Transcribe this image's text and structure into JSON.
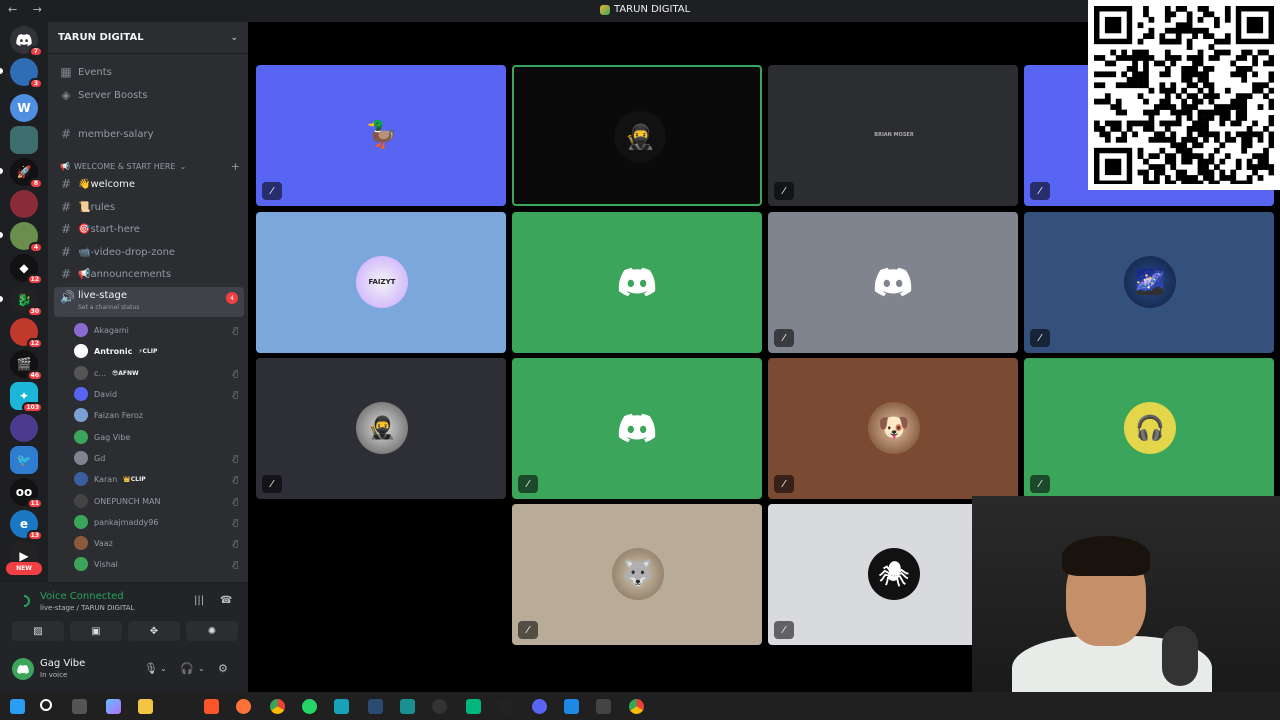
{
  "window": {
    "title": "TARUN DIGITAL",
    "nav": "← →"
  },
  "rail": {
    "badges": [
      "7",
      "3",
      "8",
      "4",
      "12",
      "30",
      "12",
      "46",
      "103",
      "11",
      "13"
    ],
    "new_label": "NEW",
    "server_names": [
      "discord-home-icon",
      "server-icon"
    ]
  },
  "sidebar": {
    "server_name": "TARUN DIGITAL",
    "items": [
      {
        "label": "Events"
      },
      {
        "label": "Server Boosts"
      },
      {
        "label": "member-salary"
      }
    ],
    "category": "WELCOME & START HERE",
    "channels": [
      {
        "label": "👋welcome"
      },
      {
        "label": "📜rules"
      },
      {
        "label": "🎯start-here"
      },
      {
        "label": "📹-video-drop-zone"
      },
      {
        "label": "📢announcements"
      }
    ],
    "voice_channel": {
      "label": "live-stage",
      "status": "Set a channel status",
      "badge": "4"
    },
    "members": [
      {
        "name": "Akagami",
        "tag": ""
      },
      {
        "name": "Antronic",
        "tag": "⚡CLIP"
      },
      {
        "name": "c...",
        "tag": "😎AFNW"
      },
      {
        "name": "David",
        "tag": ""
      },
      {
        "name": "Faizan Feroz",
        "tag": ""
      },
      {
        "name": "Gag Vibe",
        "tag": ""
      },
      {
        "name": "Gd",
        "tag": ""
      },
      {
        "name": "Karan",
        "tag": "👑CLIP"
      },
      {
        "name": "ONEPUNCH MAN",
        "tag": ""
      },
      {
        "name": "pankajmaddy96",
        "tag": ""
      },
      {
        "name": "Vaaz",
        "tag": ""
      },
      {
        "name": "Vishal",
        "tag": ""
      }
    ]
  },
  "voice": {
    "title": "Voice Connected",
    "subtitle": "live-stage / TARUN DIGITAL"
  },
  "user": {
    "name": "Gag Vibe",
    "status": "In voice"
  },
  "tiles": [
    {
      "avatar": "🦆"
    },
    {
      "avatar": "🥷"
    },
    {
      "avatar": "BRIAN MOSER"
    },
    {
      "avatar": ""
    },
    {
      "avatar": "FAIZYT"
    },
    {
      "avatar": "discord-logo"
    },
    {
      "avatar": "discord-logo"
    },
    {
      "avatar": "🌌"
    },
    {
      "avatar": "🥷"
    },
    {
      "avatar": "discord-logo"
    },
    {
      "avatar": "🐶"
    },
    {
      "avatar": "🎧"
    },
    {
      "avatar": "🐺"
    },
    {
      "avatar": "🕷"
    }
  ],
  "colors": {
    "blurple": "#5865f2",
    "green": "#3ba55c",
    "red": "#f23f43",
    "sidebar": "#2b2d31",
    "rail": "#1e1f22"
  }
}
